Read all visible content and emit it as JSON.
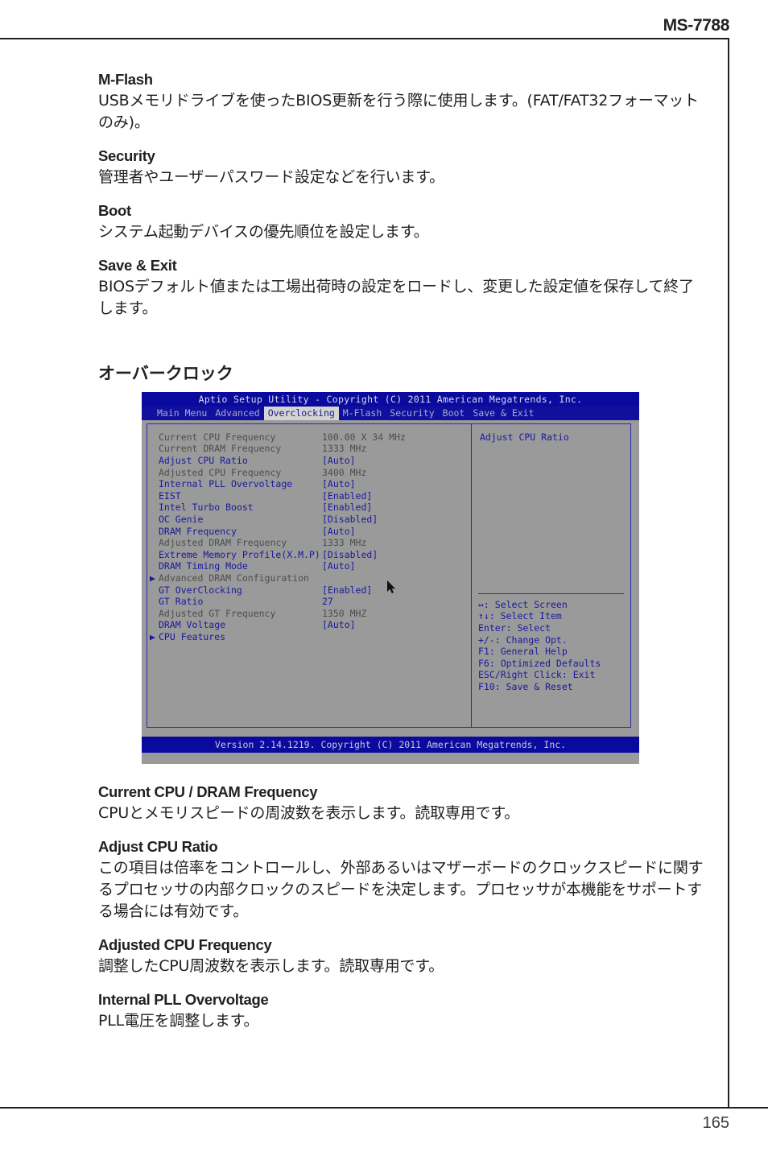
{
  "page": {
    "doc_code": "MS-7788",
    "page_number": "165"
  },
  "sections": [
    {
      "title": "M-Flash",
      "body": "USBメモリドライブを使ったBIOS更新を行う際に使用します。(FAT/FAT32フォーマットのみ)。"
    },
    {
      "title": "Security",
      "body": "管理者やユーザーパスワード設定などを行います。"
    },
    {
      "title": "Boot",
      "body": "システム起動デバイスの優先順位を設定します。"
    },
    {
      "title": "Save & Exit",
      "body": "BIOSデフォルト値または工場出荷時の設定をロードし、変更した設定値を保存して終了します。"
    }
  ],
  "overclock_heading": "オーバークロック",
  "bios": {
    "title": "Aptio Setup Utility - Copyright (C) 2011 American Megatrends, Inc.",
    "tabs": [
      {
        "label": "Main Menu",
        "active": false
      },
      {
        "label": "Advanced",
        "active": false
      },
      {
        "label": "Overclocking",
        "active": true
      },
      {
        "label": "M-Flash",
        "active": false
      },
      {
        "label": "Security",
        "active": false
      },
      {
        "label": "Boot",
        "active": false
      },
      {
        "label": "Save & Exit",
        "active": false
      }
    ],
    "items": [
      {
        "label": "Current CPU Frequency",
        "value": "100.00 X 34 MHz",
        "style": "dim",
        "submenu": false
      },
      {
        "label": "Current DRAM Frequency",
        "value": "1333 MHz",
        "style": "dim",
        "submenu": false
      },
      {
        "label": "Adjust CPU Ratio",
        "value": "[Auto]",
        "style": "normal",
        "submenu": false
      },
      {
        "label": "Adjusted CPU Frequency",
        "value": "3400 MHz",
        "style": "dim",
        "submenu": false
      },
      {
        "label": "Internal PLL Overvoltage",
        "value": "[Auto]",
        "style": "normal",
        "submenu": false
      },
      {
        "label": "EIST",
        "value": "[Enabled]",
        "style": "normal",
        "submenu": false
      },
      {
        "label": "Intel Turbo Boost",
        "value": "[Enabled]",
        "style": "normal",
        "submenu": false
      },
      {
        "label": "OC Genie",
        "value": "[Disabled]",
        "style": "normal",
        "submenu": false
      },
      {
        "label": "DRAM Frequency",
        "value": "[Auto]",
        "style": "normal",
        "submenu": false
      },
      {
        "label": "Adjusted DRAM Frequency",
        "value": "1333 MHz",
        "style": "dim",
        "submenu": false
      },
      {
        "label": "Extreme Memory Profile(X.M.P)",
        "value": "[Disabled]",
        "style": "normal",
        "submenu": false
      },
      {
        "label": "DRAM Timing Mode",
        "value": "[Auto]",
        "style": "normal",
        "submenu": false
      },
      {
        "label": "Advanced DRAM Configuration",
        "value": "",
        "style": "dim",
        "submenu": true
      },
      {
        "label": "GT OverClocking",
        "value": "[Enabled]",
        "style": "normal",
        "submenu": false
      },
      {
        "label": "GT Ratio",
        "value": "27",
        "style": "normal",
        "submenu": false
      },
      {
        "label": "Adjusted GT Frequency",
        "value": "1350 MHZ",
        "style": "dim",
        "submenu": false
      },
      {
        "label": "DRAM Voltage",
        "value": "[Auto]",
        "style": "normal",
        "submenu": false
      },
      {
        "label": "CPU Features",
        "value": "",
        "style": "normal",
        "submenu": true
      }
    ],
    "help": {
      "title": "Adjust CPU Ratio",
      "keys": [
        "↔: Select Screen",
        "↑↓: Select Item",
        "Enter: Select",
        "+/-: Change Opt.",
        "F1: General Help",
        "F6: Optimized Defaults",
        "ESC/Right Click: Exit",
        "F10: Save & Reset"
      ]
    },
    "footer": "Version 2.14.1219. Copyright (C) 2011 American Megatrends, Inc.",
    "submenu_arrow": "▶",
    "colors": {
      "screen_bg": "#9a9a9a",
      "bar_blue": "#0a0a9e",
      "text_blue": "#1a1a9c",
      "text_dim": "#4d4d4d",
      "tab_active_bg": "#d4d4d4"
    }
  },
  "descriptions": [
    {
      "title": "Current CPU / DRAM Frequency",
      "body": "CPUとメモリスピードの周波数を表示します。読取専用です。"
    },
    {
      "title": "Adjust CPU Ratio",
      "body": "この項目は倍率をコントロールし、外部あるいはマザーボードのクロックスピードに関するプロセッサの内部クロックのスピードを決定します。プロセッサが本機能をサポートする場合には有効です。"
    },
    {
      "title": "Adjusted CPU Frequency",
      "body": "調整したCPU周波数を表示します。読取専用です。"
    },
    {
      "title": "Internal PLL Overvoltage",
      "body": "PLL電圧を調整します。"
    }
  ]
}
